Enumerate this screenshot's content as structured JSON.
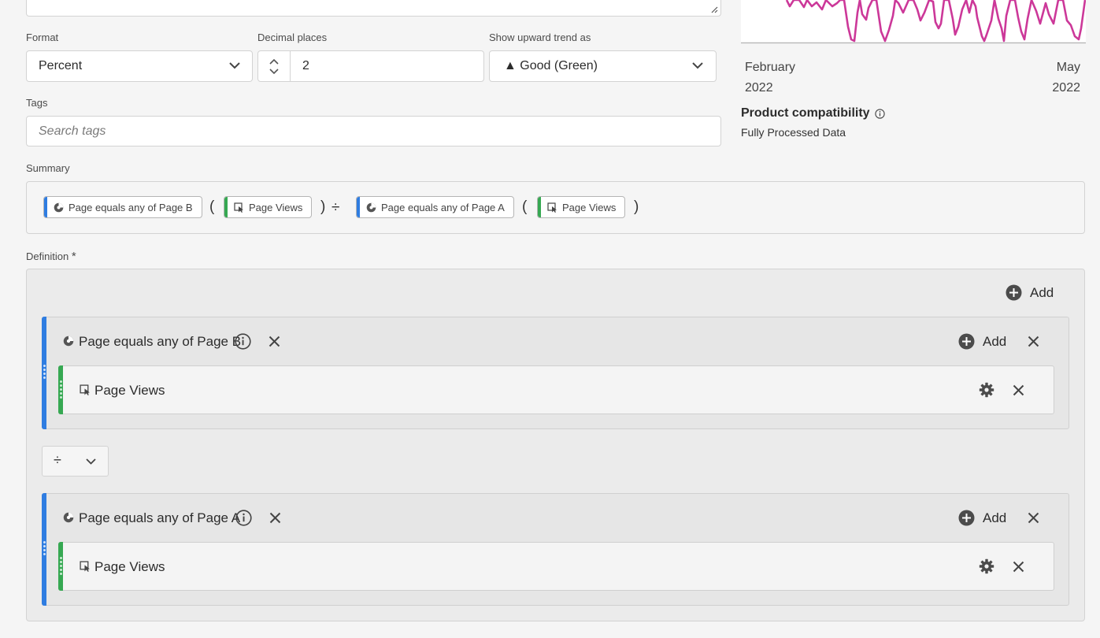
{
  "top_textarea": {
    "value": ""
  },
  "format": {
    "label": "Format",
    "value": "Percent"
  },
  "decimal": {
    "label": "Decimal places",
    "value": "2"
  },
  "trend": {
    "label": "Show upward trend as",
    "value": "▲ Good (Green)"
  },
  "tags": {
    "label": "Tags",
    "placeholder": "Search tags"
  },
  "preview": {
    "x_start_month": "February",
    "x_start_year": "2022",
    "x_end_month": "May",
    "x_end_year": "2022",
    "line_color": "#cc3899"
  },
  "compat": {
    "title": "Product compatibility",
    "value": "Fully Processed Data"
  },
  "summary": {
    "label": "Summary",
    "chips": [
      {
        "text": "Page equals any of Page B",
        "kind": "segment"
      },
      {
        "text": "Page Views",
        "kind": "metric"
      },
      {
        "text": "Page equals any of Page A",
        "kind": "segment"
      },
      {
        "text": "Page Views",
        "kind": "metric"
      }
    ],
    "open_paren": "(",
    "close_paren": ")",
    "operator": "÷"
  },
  "definition": {
    "label": "Definition",
    "required_mark": "*",
    "add_label": "Add",
    "operator": "÷",
    "containers": [
      {
        "segment": "Page equals any of Page B",
        "add_label": "Add",
        "metric": "Page Views"
      },
      {
        "segment": "Page equals any of Page A",
        "add_label": "Add",
        "metric": "Page Views"
      }
    ]
  },
  "colors": {
    "segment": "#2f7de1",
    "metric": "#36a852",
    "accent_line": "#cc3899"
  }
}
